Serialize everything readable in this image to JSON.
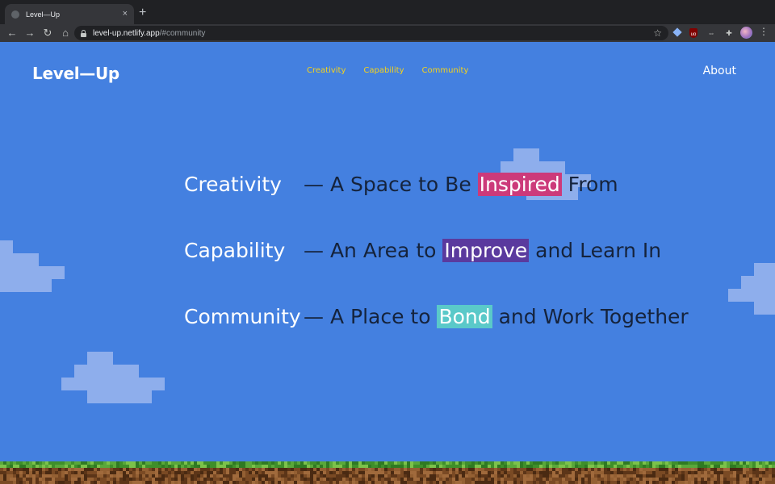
{
  "browser": {
    "tab_title": "Level—Up",
    "tab_close": "×",
    "new_tab": "+",
    "url_host": "level-up.netlify.app",
    "url_path": "/#community",
    "icons": [
      "back-icon",
      "forward-icon",
      "reload-icon",
      "home-icon",
      "lock-icon",
      "star-icon",
      "puzzle-icon",
      "menu-icon"
    ]
  },
  "site": {
    "logo": "Level—Up",
    "nav": [
      "Creativity",
      "Capability",
      "Community"
    ],
    "about": "About",
    "colors": {
      "background": "#4480e0",
      "nav_link": "#f4d21c",
      "cloud": "#8eaeec",
      "text_dark": "#15233c"
    }
  },
  "rows": [
    {
      "keyword": "Creativity",
      "prefix": "— A Space to Be ",
      "highlight": "Inspired",
      "suffix": " From",
      "color": "#cc3a7a"
    },
    {
      "keyword": "Capability",
      "prefix": "— An Area to ",
      "highlight": "Improve",
      "suffix": " and Learn In",
      "color": "#5a3a9e"
    },
    {
      "keyword": "Community",
      "prefix": "— A Place to ",
      "highlight": "Bond",
      "suffix": " and Work Together",
      "color": "#5ac9c9"
    }
  ]
}
